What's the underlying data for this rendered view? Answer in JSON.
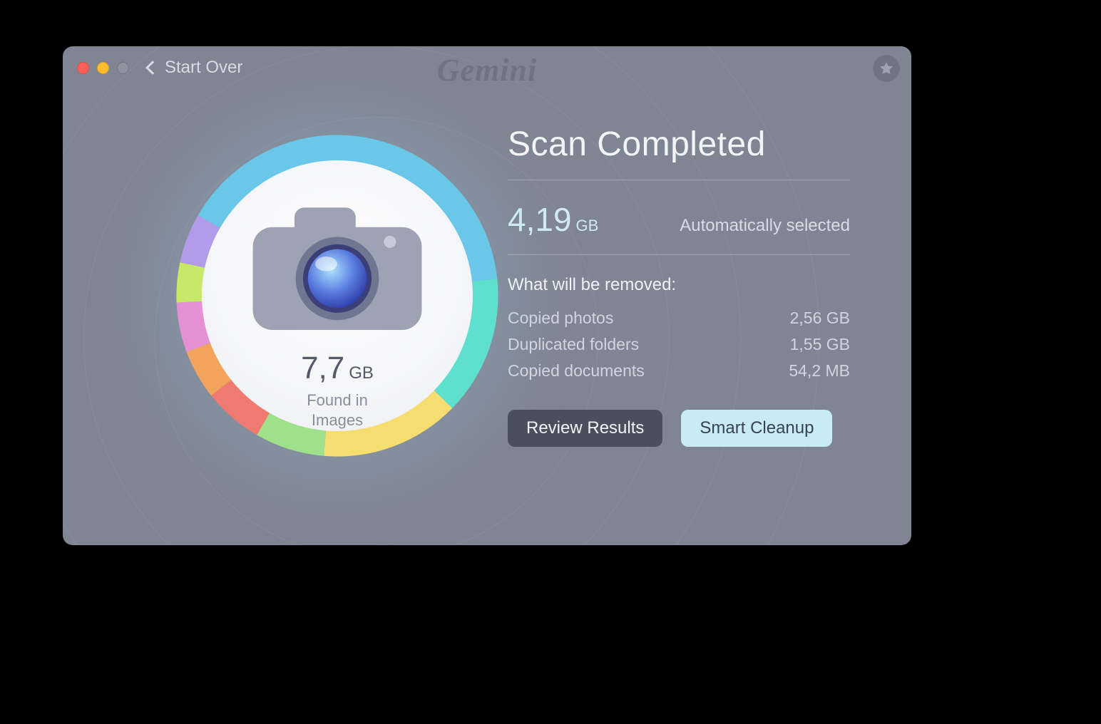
{
  "titlebar": {
    "back_label": "Start Over",
    "brand": "Gemini"
  },
  "donut": {
    "value": "7,7",
    "unit": "GB",
    "label_line1": "Found in",
    "label_line2": "Images",
    "segments": [
      {
        "name": "images",
        "color": "#6bc7e8",
        "fraction": 0.4
      },
      {
        "name": "teal",
        "color": "#5fe0cf",
        "fraction": 0.14
      },
      {
        "name": "yellow",
        "color": "#f6dd6f",
        "fraction": 0.14
      },
      {
        "name": "green",
        "color": "#9fe08a",
        "fraction": 0.07
      },
      {
        "name": "red",
        "color": "#ef7a6f",
        "fraction": 0.06
      },
      {
        "name": "orange",
        "color": "#f2a45c",
        "fraction": 0.05
      },
      {
        "name": "pink",
        "color": "#e58fd4",
        "fraction": 0.05
      },
      {
        "name": "lime",
        "color": "#c7e86b",
        "fraction": 0.04
      },
      {
        "name": "purple",
        "color": "#b29be8",
        "fraction": 0.05
      }
    ]
  },
  "panel": {
    "heading": "Scan Completed",
    "selected_value": "4,19",
    "selected_unit": "GB",
    "selected_label": "Automatically selected",
    "list_heading": "What will be removed:",
    "items": [
      {
        "label": "Copied photos",
        "size": "2,56 GB"
      },
      {
        "label": "Duplicated folders",
        "size": "1,55 GB"
      },
      {
        "label": "Copied documents",
        "size": "54,2 MB"
      }
    ],
    "review_label": "Review Results",
    "cleanup_label": "Smart Cleanup"
  }
}
